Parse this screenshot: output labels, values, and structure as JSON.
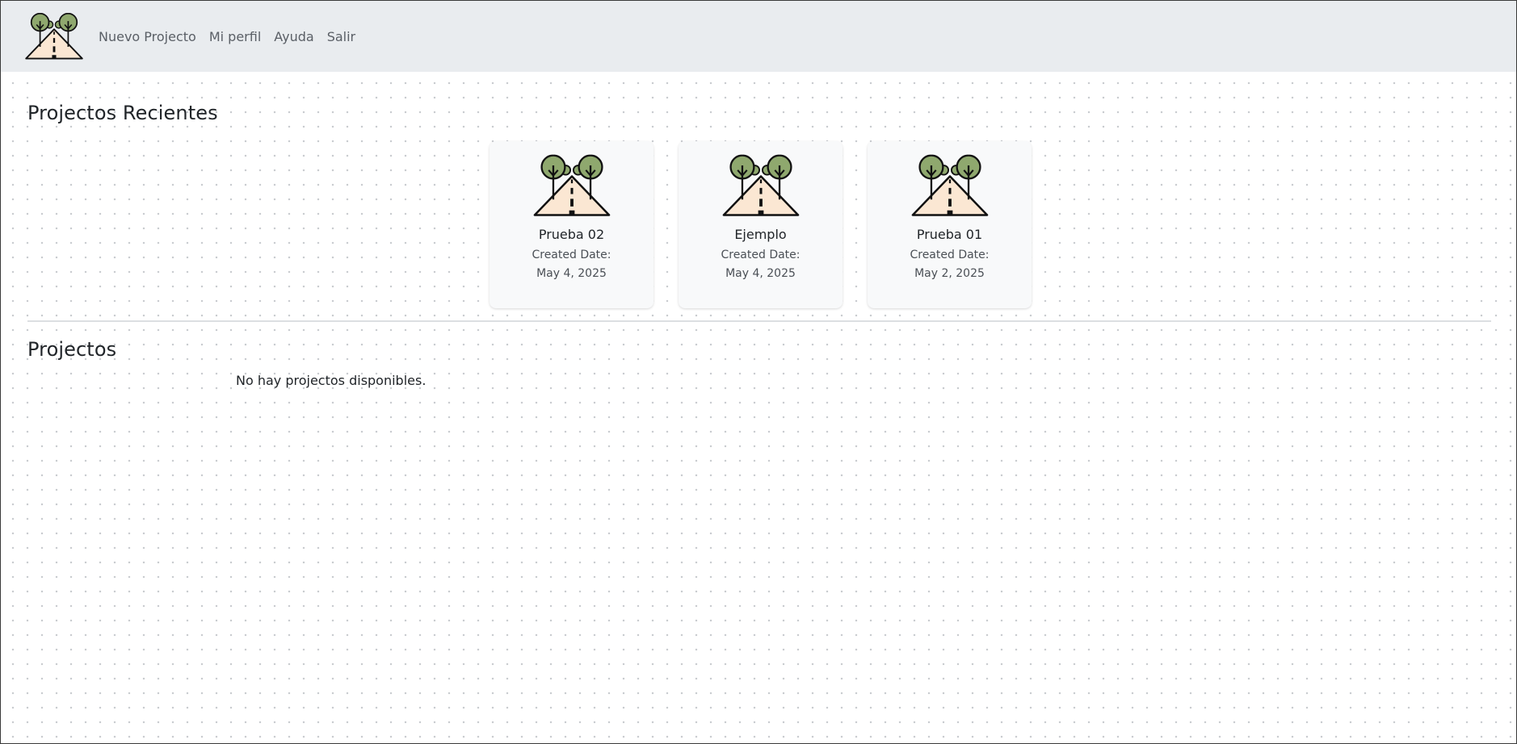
{
  "navbar": {
    "logo_icon": "road-trees-logo-icon",
    "links": [
      {
        "label": "Nuevo Projecto"
      },
      {
        "label": "Mi perfil"
      },
      {
        "label": "Ayuda"
      },
      {
        "label": "Salir"
      }
    ]
  },
  "recent": {
    "title": "Projectos Recientes",
    "cards": [
      {
        "icon": "road-trees-icon",
        "name": "Prueba 02",
        "created_label": "Created Date:",
        "date": "May 4, 2025"
      },
      {
        "icon": "road-trees-icon",
        "name": "Ejemplo",
        "created_label": "Created Date:",
        "date": "May 4, 2025"
      },
      {
        "icon": "road-trees-icon",
        "name": "Prueba 01",
        "created_label": "Created Date:",
        "date": "May 2, 2025"
      }
    ]
  },
  "projects": {
    "title": "Projectos",
    "empty_message": "No hay projectos disponibles."
  },
  "colors": {
    "navbar_bg": "#e9ecef",
    "card_bg": "#f8f9fa",
    "tree_green": "#8fa86e",
    "road_fill": "#fbe7d3"
  }
}
